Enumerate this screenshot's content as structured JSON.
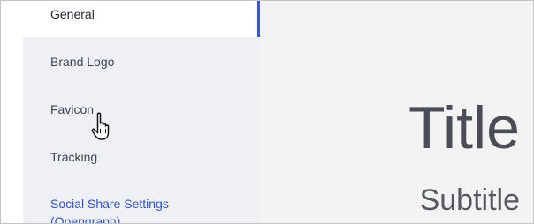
{
  "sidebar": {
    "items": [
      {
        "label": "General",
        "active": true
      },
      {
        "label": "Brand Logo"
      },
      {
        "label": "Favicon"
      },
      {
        "label": "Tracking"
      },
      {
        "label": "Social Share Settings (Opengraph)",
        "line1": "Social Share Settings",
        "line2": "(Opengraph)"
      }
    ]
  },
  "preview": {
    "title": "Title",
    "subtitle": "Subtitle"
  },
  "colors": {
    "sidebar_bg": "#eff0f6",
    "active_indicator": "#3a59d1",
    "link": "#2f55c8",
    "preview_bg": "#f3f3f3"
  },
  "cursor": {
    "icon": "hand-pointer-icon"
  }
}
